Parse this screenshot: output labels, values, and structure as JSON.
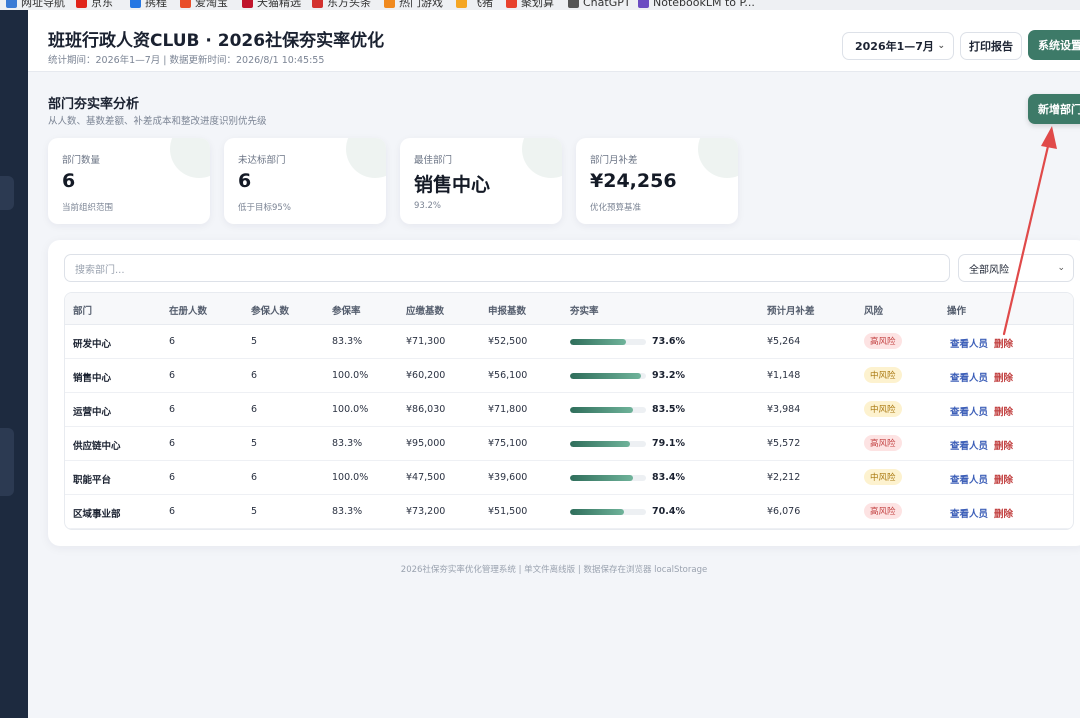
{
  "bookmarks": [
    {
      "label": "网址导航",
      "color": "#3a7bd5"
    },
    {
      "label": "京东",
      "color": "#e1251b"
    },
    {
      "label": "携程",
      "color": "#2577e3"
    },
    {
      "label": "爱淘宝",
      "color": "#e94e2a"
    },
    {
      "label": "天猫精选",
      "color": "#c0142b"
    },
    {
      "label": "东方头条",
      "color": "#d3322f"
    },
    {
      "label": "热门游戏",
      "color": "#f08a1f"
    },
    {
      "label": "飞猪",
      "color": "#f5a623"
    },
    {
      "label": "聚划算",
      "color": "#e8412c"
    },
    {
      "label": "ChatGPT",
      "color": "#555555"
    },
    {
      "label": "NotebookLM to P...",
      "color": "#6b4cc2"
    }
  ],
  "header": {
    "title": "班班行政人资CLUB · 2026社保夯实率优化",
    "subtitle": "统计期间：2026年1—7月 | 数据更新时间：2026/8/1 10:45:55",
    "period_select": "2026年1—7月",
    "print_label": "打印报告",
    "settings_label": "系统设置"
  },
  "section": {
    "title": "部门夯实率分析",
    "subtitle": "从人数、基数差额、补差成本和整改进度识别优先级",
    "add_label": "新增部门"
  },
  "kpis": [
    {
      "label": "部门数量",
      "value": "6",
      "note": "当前组织范围"
    },
    {
      "label": "未达标部门",
      "value": "6",
      "note": "低于目标95%"
    },
    {
      "label": "最佳部门",
      "value": "销售中心",
      "note": "93.2%"
    },
    {
      "label": "部门月补差",
      "value": "¥24,256",
      "note": "优化预算基准"
    }
  ],
  "filters": {
    "search_placeholder": "搜索部门...",
    "risk_select": "全部风险"
  },
  "table": {
    "headers": [
      "部门",
      "在册人数",
      "参保人数",
      "参保率",
      "应缴基数",
      "申报基数",
      "夯实率",
      "预计月补差",
      "风险",
      "操作"
    ],
    "view_label": "查看人员",
    "delete_label": "删除",
    "rows": [
      {
        "dept": "研发中心",
        "staff": "6",
        "insured": "5",
        "coverage": "83.3%",
        "due_base": "¥71,300",
        "declared_base": "¥52,500",
        "rate": 73.6,
        "rate_label": "73.6%",
        "gap": "¥5,264",
        "risk": "高风险",
        "risk_level": "high"
      },
      {
        "dept": "销售中心",
        "staff": "6",
        "insured": "6",
        "coverage": "100.0%",
        "due_base": "¥60,200",
        "declared_base": "¥56,100",
        "rate": 93.2,
        "rate_label": "93.2%",
        "gap": "¥1,148",
        "risk": "中风险",
        "risk_level": "mid"
      },
      {
        "dept": "运营中心",
        "staff": "6",
        "insured": "6",
        "coverage": "100.0%",
        "due_base": "¥86,030",
        "declared_base": "¥71,800",
        "rate": 83.5,
        "rate_label": "83.5%",
        "gap": "¥3,984",
        "risk": "中风险",
        "risk_level": "mid"
      },
      {
        "dept": "供应链中心",
        "staff": "6",
        "insured": "5",
        "coverage": "83.3%",
        "due_base": "¥95,000",
        "declared_base": "¥75,100",
        "rate": 79.1,
        "rate_label": "79.1%",
        "gap": "¥5,572",
        "risk": "高风险",
        "risk_level": "high"
      },
      {
        "dept": "职能平台",
        "staff": "6",
        "insured": "6",
        "coverage": "100.0%",
        "due_base": "¥47,500",
        "declared_base": "¥39,600",
        "rate": 83.4,
        "rate_label": "83.4%",
        "gap": "¥2,212",
        "risk": "中风险",
        "risk_level": "mid"
      },
      {
        "dept": "区域事业部",
        "staff": "6",
        "insured": "5",
        "coverage": "83.3%",
        "due_base": "¥73,200",
        "declared_base": "¥51,500",
        "rate": 70.4,
        "rate_label": "70.4%",
        "gap": "¥6,076",
        "risk": "高风险",
        "risk_level": "high"
      }
    ]
  },
  "footer": "2026社保夯实率优化管理系统 | 单文件离线版 | 数据保存在浏览器 localStorage",
  "colors": {
    "accent": "#3d7a68",
    "sidebar": "#1d2a3f",
    "danger": "#c24141",
    "link": "#3d5fb8",
    "annotation_arrow": "#e04a4a"
  }
}
